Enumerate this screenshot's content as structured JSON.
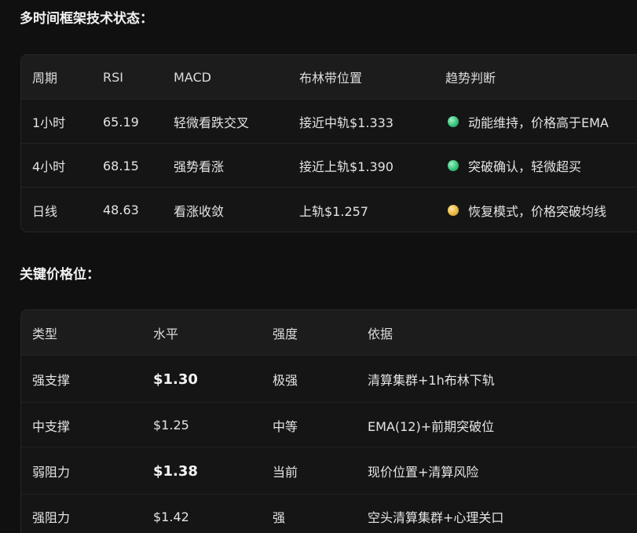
{
  "section1": {
    "title": "多时间框架技术状态：",
    "headers": [
      "周期",
      "RSI",
      "MACD",
      "布林带位置",
      "趋势判断"
    ],
    "rows": [
      {
        "period": "1小时",
        "rsi": "65.19",
        "macd": "轻微看跌交叉",
        "bollinger": "接近中轨$1.333",
        "trend": "动能维持，价格高于EMA",
        "indicator": "green"
      },
      {
        "period": "4小时",
        "rsi": "68.15",
        "macd": "强势看涨",
        "bollinger": "接近上轨$1.390",
        "trend": "突破确认，轻微超买",
        "indicator": "green"
      },
      {
        "period": "日线",
        "rsi": "48.63",
        "macd": "看涨收敛",
        "bollinger": "上轨$1.257",
        "trend": "恢复模式，价格突破均线",
        "indicator": "yellow"
      }
    ]
  },
  "section2": {
    "title": "关键价格位：",
    "headers": [
      "类型",
      "水平",
      "强度",
      "依据"
    ],
    "rows": [
      {
        "type": "强支撑",
        "level": "$1.30",
        "strength": "极强",
        "basis": "清算集群+1h布林下轨",
        "emphasis": true
      },
      {
        "type": "中支撑",
        "level": "$1.25",
        "strength": "中等",
        "basis": "EMA(12)+前期突破位",
        "emphasis": false
      },
      {
        "type": "弱阻力",
        "level": "$1.38",
        "strength": "当前",
        "basis": "现价位置+清算风险",
        "emphasis": true
      },
      {
        "type": "强阻力",
        "level": "$1.42",
        "strength": "强",
        "basis": "空头清算集群+心理关口",
        "emphasis": false
      }
    ]
  },
  "colors": {
    "background": "#101010",
    "indicator_green": "#2fbf74",
    "indicator_yellow": "#e8b33a"
  }
}
